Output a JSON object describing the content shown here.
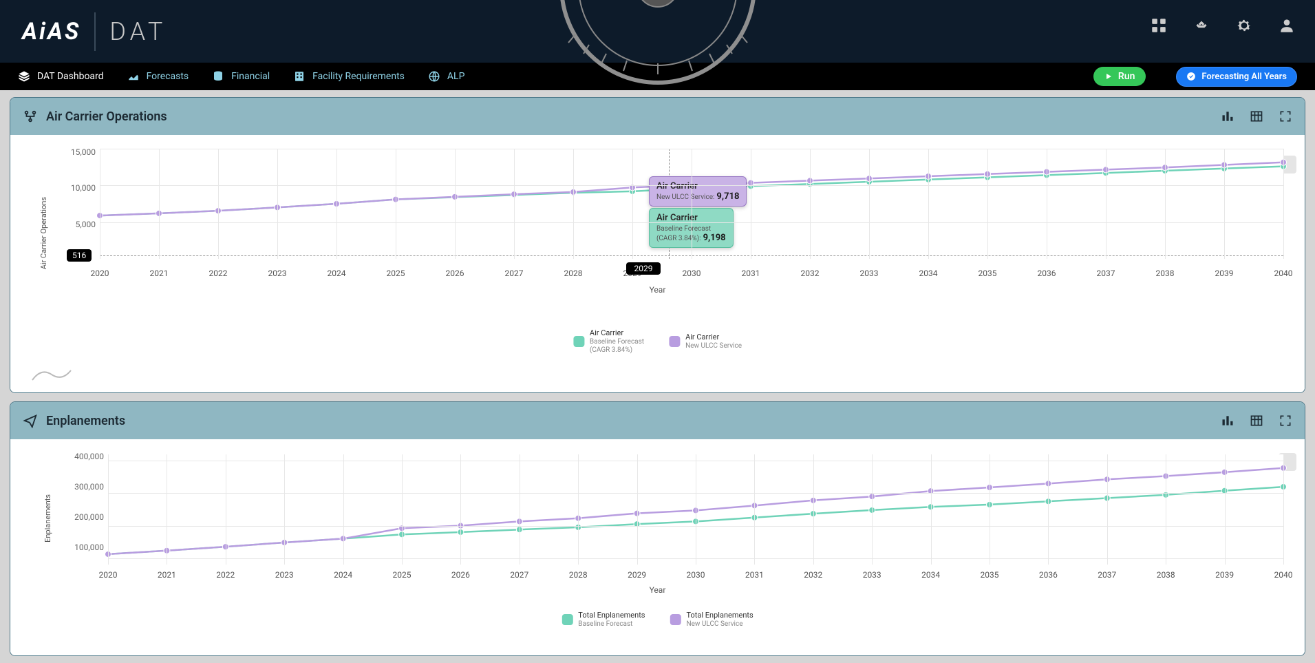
{
  "brand": {
    "logo_left": "AiAS",
    "logo_right": "DAT"
  },
  "menu": {
    "dashboard": "DAT Dashboard",
    "forecasts": "Forecasts",
    "financial": "Financial",
    "facility": "Facility Requirements",
    "alp": "ALP"
  },
  "buttons": {
    "run": "Run",
    "forecast_all": "Forecasting All Years"
  },
  "panel1": {
    "title": "Air Carrier Operations",
    "xlabel": "Year",
    "ylabel": "Air Carrier Operations",
    "legend": {
      "s1_h": "Air Carrier",
      "s1_s1": "Baseline Forecast",
      "s1_s2": "(CAGR 3.84%)",
      "s2_h": "Air Carrier",
      "s2_s1": "New ULCC Service"
    },
    "hover_label": "2029",
    "axis_tag": "516",
    "tooltip": {
      "p_h": "Air Carrier",
      "p_s": "New ULCC Service:",
      "p_v": "9,718",
      "g_h": "Air Carrier",
      "g_s": "Baseline Forecast",
      "g_s2": "(CAGR 3.84%):",
      "g_v": "9,198"
    }
  },
  "panel2": {
    "title": "Enplanements",
    "xlabel": "Year",
    "ylabel": "Enplanements",
    "legend": {
      "s1_h": "Total Enplanements",
      "s1_s": "Baseline Forecast",
      "s2_h": "Total Enplanements",
      "s2_s": "New ULCC Service"
    }
  },
  "colors": {
    "teal": "#6fd3b8",
    "purple": "#b89de0",
    "tealStroke": "#47c2a3",
    "purpleStroke": "#a285d0"
  },
  "chart_data": [
    {
      "type": "line",
      "panel": "Air Carrier Operations",
      "xlabel": "Year",
      "ylabel": "Air Carrier Operations",
      "ylim": [
        0,
        15000
      ],
      "yticks": [
        5000,
        10000,
        15000
      ],
      "baseline": 516,
      "categories": [
        2020,
        2021,
        2022,
        2023,
        2024,
        2025,
        2026,
        2027,
        2028,
        2029,
        2030,
        2031,
        2032,
        2033,
        2034,
        2035,
        2036,
        2037,
        2038,
        2039,
        2040
      ],
      "series": [
        {
          "name": "Air Carrier Baseline Forecast (CAGR 3.84%)",
          "color": "#6fd3b8",
          "values": [
            5900,
            6200,
            6550,
            7000,
            7500,
            8100,
            8400,
            8700,
            9000,
            9198,
            9600,
            9900,
            10200,
            10500,
            10800,
            11100,
            11400,
            11700,
            12000,
            12300,
            12600
          ]
        },
        {
          "name": "Air Carrier New ULCC Service",
          "color": "#b89de0",
          "values": [
            5900,
            6200,
            6550,
            7000,
            7500,
            8100,
            8450,
            8800,
            9100,
            9718,
            10050,
            10350,
            10650,
            10950,
            11250,
            11550,
            11850,
            12150,
            12450,
            12800,
            13150
          ]
        }
      ]
    },
    {
      "type": "line",
      "panel": "Enplanements",
      "xlabel": "Year",
      "ylabel": "Enplanements",
      "ylim": [
        80000,
        400000
      ],
      "yticks": [
        100000,
        200000,
        300000,
        400000
      ],
      "categories": [
        2020,
        2021,
        2022,
        2023,
        2024,
        2025,
        2026,
        2027,
        2028,
        2029,
        2030,
        2031,
        2032,
        2033,
        2034,
        2035,
        2036,
        2037,
        2038,
        2039,
        2040
      ],
      "series": [
        {
          "name": "Total Enplanements Baseline Forecast",
          "color": "#6fd3b8",
          "values": [
            112000,
            123000,
            135000,
            148000,
            160000,
            173000,
            180000,
            188000,
            195000,
            205000,
            213000,
            225000,
            237000,
            248000,
            258000,
            265000,
            275000,
            285000,
            295000,
            308000,
            320000
          ]
        },
        {
          "name": "Total Enplanements New ULCC Service",
          "color": "#b89de0",
          "values": [
            112000,
            123000,
            135000,
            148000,
            160000,
            192000,
            200000,
            213000,
            223000,
            238000,
            247000,
            262000,
            278000,
            290000,
            307000,
            318000,
            330000,
            343000,
            353000,
            365000,
            378000
          ]
        }
      ]
    }
  ]
}
